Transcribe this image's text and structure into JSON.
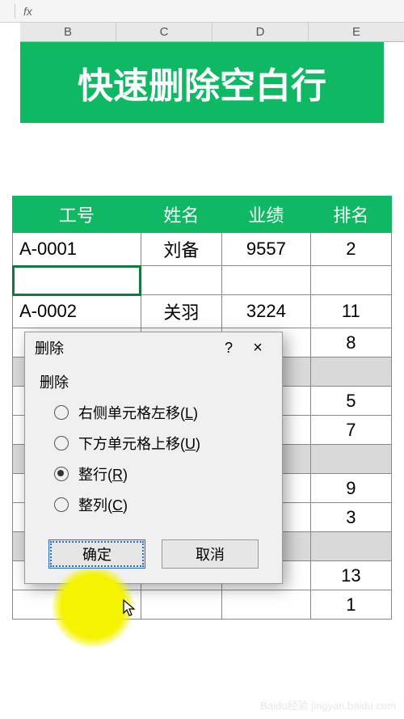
{
  "formula_bar": {
    "fx": "fx"
  },
  "columns": [
    "B",
    "C",
    "D",
    "E"
  ],
  "banner": "快速删除空白行",
  "table": {
    "headers": [
      "工号",
      "姓名",
      "业绩",
      "排名"
    ],
    "rows": [
      {
        "type": "data",
        "cells": [
          "A-0001",
          "刘备",
          "9557",
          "2"
        ]
      },
      {
        "type": "selected-blank",
        "cells": [
          "",
          "",
          "",
          ""
        ]
      },
      {
        "type": "data",
        "cells": [
          "A-0002",
          "关羽",
          "3224",
          "11"
        ]
      },
      {
        "type": "partial",
        "cells": [
          "",
          "",
          "",
          "8"
        ]
      },
      {
        "type": "blank",
        "cells": [
          "",
          "",
          "",
          ""
        ]
      },
      {
        "type": "partial",
        "cells": [
          "",
          "",
          "",
          "5"
        ]
      },
      {
        "type": "partial",
        "cells": [
          "",
          "",
          "",
          "7"
        ]
      },
      {
        "type": "blank",
        "cells": [
          "",
          "",
          "",
          ""
        ]
      },
      {
        "type": "partial",
        "cells": [
          "",
          "",
          "",
          "9"
        ]
      },
      {
        "type": "partial",
        "cells": [
          "",
          "",
          "",
          "3"
        ]
      },
      {
        "type": "blank",
        "cells": [
          "",
          "",
          "",
          ""
        ]
      },
      {
        "type": "partial",
        "cells": [
          "",
          "",
          "",
          "13"
        ]
      },
      {
        "type": "partial",
        "cells": [
          "",
          "",
          "",
          "1"
        ]
      }
    ]
  },
  "dialog": {
    "title": "删除",
    "group_label": "删除",
    "options": [
      {
        "label": "右侧单元格左移",
        "accel": "L",
        "checked": false
      },
      {
        "label": "下方单元格上移",
        "accel": "U",
        "checked": false
      },
      {
        "label": "整行",
        "accel": "R",
        "checked": true
      },
      {
        "label": "整列",
        "accel": "C",
        "checked": false
      }
    ],
    "ok": "确定",
    "cancel": "取消"
  },
  "watermark": "Baidu经验 jingyan.baidu.com"
}
